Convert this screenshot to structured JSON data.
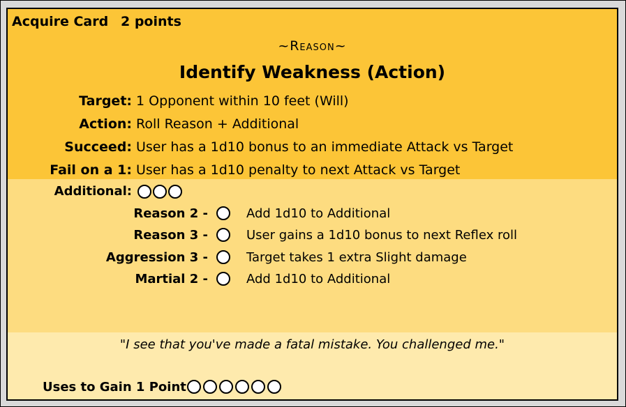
{
  "card": {
    "acquire_label": "Acquire Card",
    "points_label": "2 points",
    "school": "~Reason~",
    "title": "Identify Weakness (Action)",
    "rows": [
      {
        "label": "Target:",
        "value": "1 Opponent within 10 feet (Will)"
      },
      {
        "label": "Action:",
        "value": "Roll Reason + Additional"
      },
      {
        "label": "Succeed:",
        "value": "User has a 1d10 bonus to an immediate Attack vs Target"
      },
      {
        "label": "Fail on a 1:",
        "value": "User has a 1d10 penalty to next Attack vs Target"
      }
    ],
    "additional": {
      "label": "Additional:",
      "boxes": 3
    },
    "upgrades": [
      {
        "label": "Reason 2 -",
        "desc": "Add 1d10 to Additional"
      },
      {
        "label": "Reason 3 -",
        "desc": "User gains a 1d10 bonus to next Reflex roll"
      },
      {
        "label": "Aggression 3 -",
        "desc": "Target takes 1 extra Slight damage"
      },
      {
        "label": "Martial 2 -",
        "desc": "Add 1d10 to Additional"
      }
    ],
    "quote": "\"I see that you've made a fatal mistake. You challenged me.\"",
    "uses": {
      "label": "Uses to Gain 1 Point",
      "boxes": 6
    },
    "colors": {
      "top_band": "#fcc537",
      "middle_band": "#fddc80",
      "bottom_band": "#feeaad",
      "frame": "#d9d9d9"
    }
  }
}
